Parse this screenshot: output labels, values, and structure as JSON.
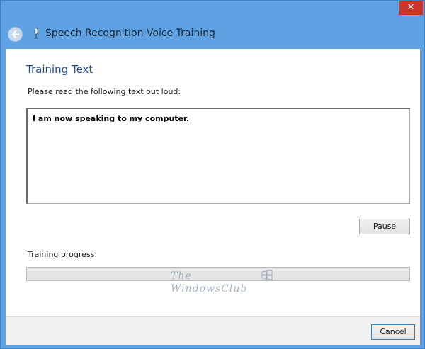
{
  "window": {
    "title": "Speech Recognition Voice Training",
    "close_glyph": "✕",
    "accent_color": "#5ea2e4"
  },
  "icons": {
    "back": "back-arrow-icon",
    "microphone": "microphone-icon",
    "close": "close-icon"
  },
  "main": {
    "heading": "Training Text",
    "instruction": "Please read the following text out loud:",
    "training_text": "I am now speaking to my computer.",
    "pause_label": "Pause",
    "progress_label": "Training progress:",
    "progress_fraction": 0.0
  },
  "watermark": {
    "line1": "The",
    "line2": "WindowsClub"
  },
  "footer": {
    "cancel_label": "Cancel"
  }
}
